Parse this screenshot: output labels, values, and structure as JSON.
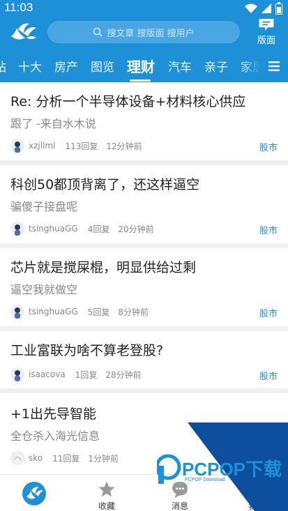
{
  "status": {
    "time": "11:03"
  },
  "header": {
    "search_placeholder": "搜文章 搜版面 搜用户",
    "layout_label": "版面"
  },
  "tabs": [
    {
      "label": "站"
    },
    {
      "label": "十大"
    },
    {
      "label": "房产"
    },
    {
      "label": "图览"
    },
    {
      "label": "理财",
      "active": true
    },
    {
      "label": "汽车"
    },
    {
      "label": "亲子"
    },
    {
      "label": "家居"
    }
  ],
  "posts": [
    {
      "title": "Re: 分析一个半导体设备+材料核心供应",
      "subtitle": "跟了 -来自水木说",
      "user": "xzjllml",
      "replies": "113回复",
      "time": "12分钟前",
      "tag": "股市"
    },
    {
      "title": "科创50都顶背离了，还这样逼空",
      "subtitle": "骗傻子接盘呢",
      "user": "tsinghuaGG",
      "replies": "4回复",
      "time": "20分钟前",
      "tag": "股市"
    },
    {
      "title": "芯片就是搅屎棍，明显供给过剩",
      "subtitle": "逼空我就做空",
      "user": "tsinghuaGG",
      "replies": "5回复",
      "time": "8分钟前",
      "tag": "股市"
    },
    {
      "title": "工业富联为啥不算老登股?",
      "subtitle": "",
      "user": "isaacova",
      "replies": "1回复",
      "time": "28分钟前",
      "tag": "股市"
    },
    {
      "title": "+1出先导智能",
      "subtitle": "全仓杀入海光信息",
      "user": "sko",
      "replies": "11回复",
      "time": "1分钟前",
      "tag": ""
    }
  ],
  "bottom_nav": [
    {
      "label": ""
    },
    {
      "label": "收藏"
    },
    {
      "label": "消息"
    },
    {
      "label": "我"
    }
  ],
  "watermark": {
    "brand": "PCPOP下载",
    "sub": "PCPOP Download"
  },
  "colors": {
    "primary": "#1e90d8",
    "tag": "#1e90d8",
    "watermark": "#0d4f9e"
  }
}
